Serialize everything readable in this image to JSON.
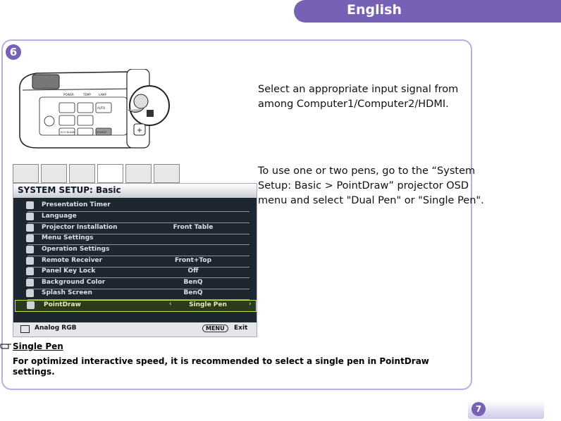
{
  "header": {
    "language_tab": "English"
  },
  "step": {
    "number": "6"
  },
  "instructions": {
    "line1a": "Select an appropriate input signal from",
    "line1b": "among Computer1/Computer2/HDMI.",
    "line2a": "To use one or two pens, go to the “System",
    "line2b": "Setup: Basic > PointDraw” projector OSD",
    "line2c": "menu and select \"Dual Pen\" or \"Single Pen\"."
  },
  "osd": {
    "title": "SYSTEM SETUP: Basic",
    "rows": [
      {
        "label": "Presentation Timer",
        "value": ""
      },
      {
        "label": "Language",
        "value": ""
      },
      {
        "label": "Projector Installation",
        "value": "Front Table"
      },
      {
        "label": "Menu Settings",
        "value": ""
      },
      {
        "label": "Operation Settings",
        "value": ""
      },
      {
        "label": "Remote Receiver",
        "value": "Front+Top"
      },
      {
        "label": "Panel Key Lock",
        "value": "Off"
      },
      {
        "label": "Background Color",
        "value": "BenQ"
      },
      {
        "label": "Splash Screen",
        "value": "BenQ"
      },
      {
        "label": "PointDraw",
        "value": "Single Pen"
      }
    ],
    "footer": {
      "source": "Analog RGB",
      "menu_key": "MENU",
      "exit": "Exit"
    },
    "tab_icons": [
      "picture-icon",
      "picture-advanced-icon",
      "display-icon",
      "system-setup-basic-icon",
      "system-setup-advanced-icon",
      "information-icon"
    ]
  },
  "projector_panel": {
    "labels": [
      "POWER",
      "TEMP",
      "LAMP",
      "AUTO",
      "ECO BLANK",
      "SOURCE",
      "MENU EXIT",
      "MODE ENTER"
    ]
  },
  "note": {
    "heading": "Single Pen",
    "body": "For optimized interactive speed, it is recommended to select a single pen in PointDraw settings."
  },
  "footer": {
    "page_number": "7"
  },
  "colors": {
    "accent": "#7661b6",
    "card_border": "#b9aee0"
  }
}
